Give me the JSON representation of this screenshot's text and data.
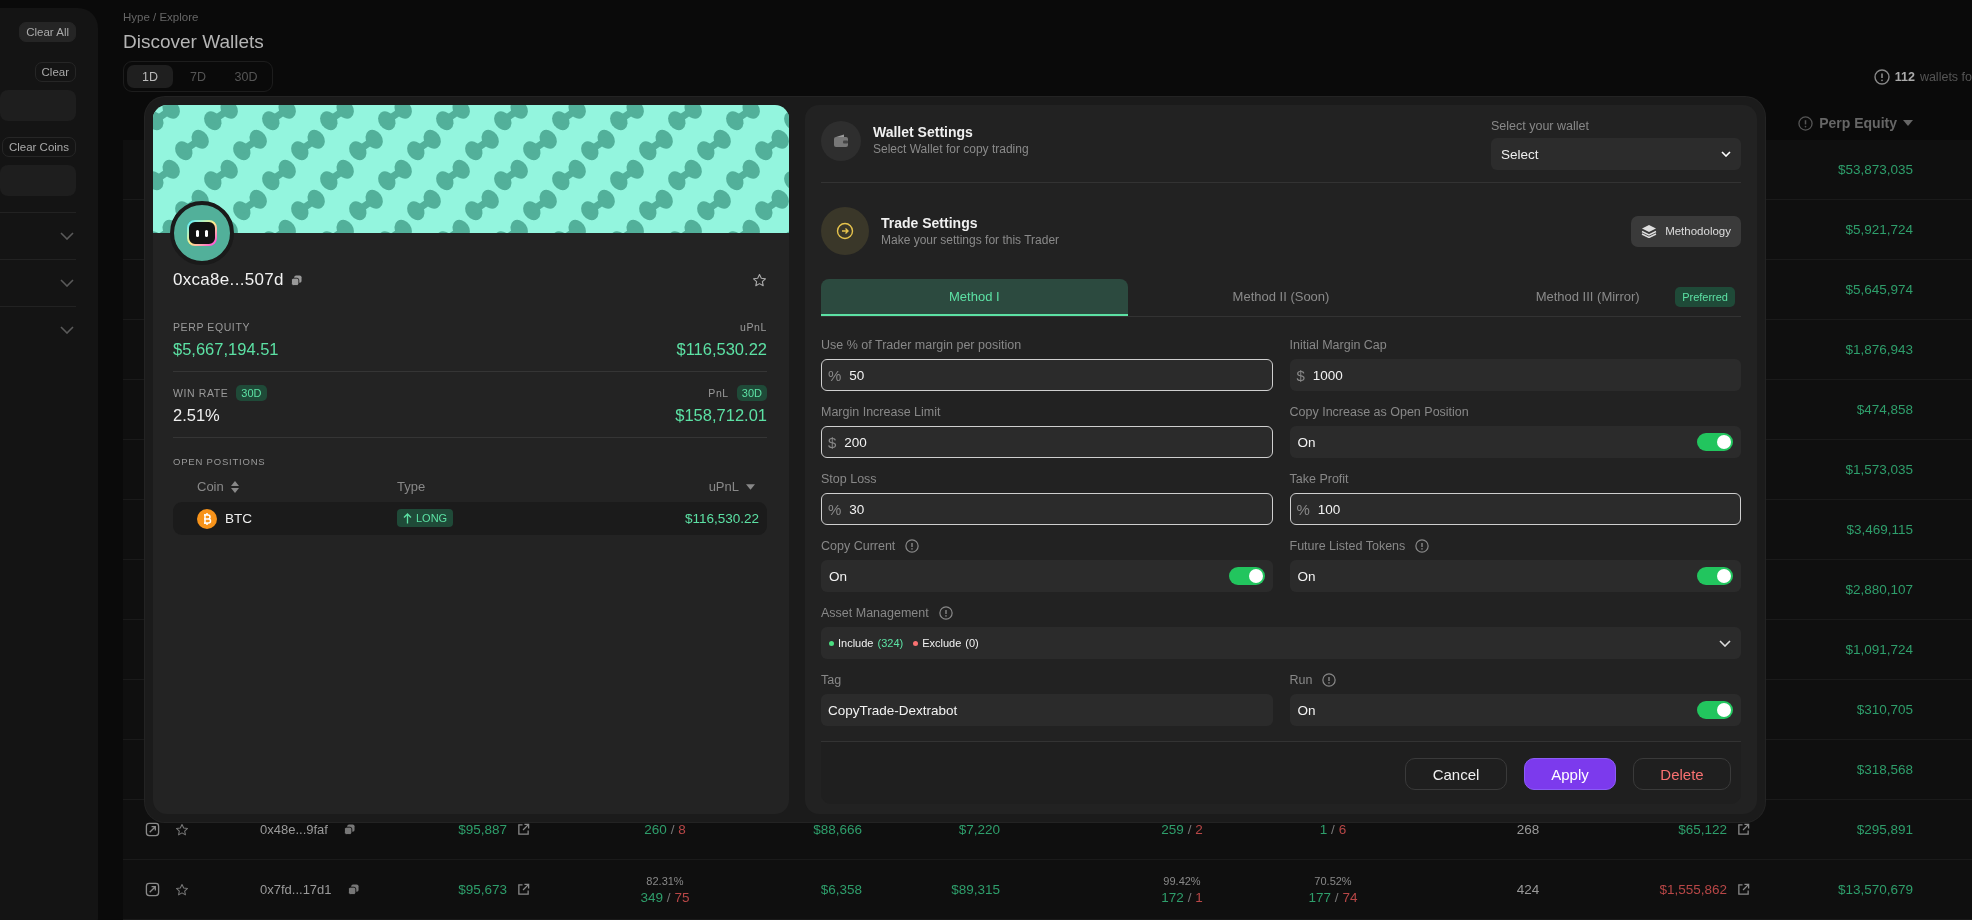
{
  "sidebar": {
    "items": [
      {
        "kind": "action",
        "label": "Clear All",
        "filled": true
      },
      {
        "kind": "action",
        "label": "Clear",
        "filled": false
      },
      {
        "kind": "field"
      },
      {
        "kind": "action",
        "label": "Clear Coins",
        "filled": false
      },
      {
        "kind": "field"
      },
      {
        "kind": "dropdown"
      },
      {
        "kind": "dropdown"
      },
      {
        "kind": "dropdown"
      }
    ]
  },
  "header": {
    "breadcrumb": "Hype / Explore",
    "title": "Discover Wallets",
    "periods": [
      {
        "label": "1D",
        "selected": true
      },
      {
        "label": "7D",
        "selected": false
      },
      {
        "label": "30D",
        "selected": false
      }
    ],
    "wallet_count": {
      "count": "112",
      "text": "wallets fo"
    }
  },
  "table": {
    "columns": [
      {
        "label": "Perp Equity",
        "sorted": true
      }
    ],
    "rows": [
      {
        "perp_equity": "$53,873,035"
      },
      {
        "perp_equity": "$5,921,724"
      },
      {
        "perp_equity": "$5,645,974"
      },
      {
        "perp_equity": "$1,876,943"
      },
      {
        "perp_equity": "$474,858"
      },
      {
        "perp_equity": "$1,573,035"
      },
      {
        "perp_equity": "$3,469,115"
      },
      {
        "perp_equity": "$2,880,107"
      },
      {
        "perp_equity": "$1,091,724"
      },
      {
        "perp_equity": "$310,705"
      },
      {
        "perp_equity": "$318,568"
      },
      {
        "address": "0x48e...9faf",
        "column_3": "$95,887",
        "column_4": {
          "wins": "260",
          "separator": "/",
          "losses": "8"
        },
        "column_5": "$88,666",
        "column_6": "$7,220",
        "column_7": {
          "wins": "259",
          "separator": "/",
          "losses": "2"
        },
        "column_8": {
          "wins": "1",
          "separator": "/",
          "losses": "6"
        },
        "column_9": "268",
        "column_10": {
          "value": "$65,122",
          "loss": false
        },
        "perp_equity": "$295,891"
      },
      {
        "address": "0x7fd...17d1",
        "column_3": "$95,673",
        "column_4": {
          "rate": "82.31%",
          "wins": "349",
          "separator": "/",
          "losses": "75"
        },
        "column_5": "$6,358",
        "column_6": "$89,315",
        "column_7": {
          "rate": "99.42%",
          "wins": "172",
          "separator": "/",
          "losses": "1"
        },
        "column_8": {
          "rate": "70.52%",
          "wins": "177",
          "separator": "/",
          "losses": "74"
        },
        "column_9": "424",
        "column_10": {
          "value": "$1,555,862",
          "loss": true
        },
        "perp_equity": "$13,570,679"
      }
    ]
  },
  "trader": {
    "address": "0xca8e...507d",
    "stats": [
      {
        "label": "PERP EQUITY",
        "value": "$5,667,194.51",
        "gain": true
      },
      {
        "label": "uPnL",
        "value": "$116,530.22",
        "gain": true
      },
      {
        "label": "WIN RATE",
        "badge": "30D",
        "value": "2.51%",
        "gain": false
      },
      {
        "label": "PnL",
        "badge": "30D",
        "value": "$158,712.01",
        "gain": true
      }
    ],
    "open_positions": {
      "title": "OPEN POSITIONS",
      "columns": [
        {
          "label": "Coin",
          "sortable": true,
          "sorted": false
        },
        {
          "label": "Type",
          "sortable": false,
          "sorted": false
        },
        {
          "label": "uPnL",
          "sortable": false,
          "sorted": true
        }
      ],
      "rows": [
        {
          "coin": "BTC",
          "type": "LONG",
          "upnl": "$116,530.22"
        }
      ]
    }
  },
  "settings": {
    "wallet": {
      "title": "Wallet Settings",
      "subtitle": "Select Wallet for copy trading",
      "select_label": "Select your wallet",
      "select_value": "Select"
    },
    "trade": {
      "title": "Trade Settings",
      "subtitle": "Make your settings for this Trader",
      "methodology": "Methodology"
    },
    "methods": [
      {
        "label": "Method I",
        "selected": true
      },
      {
        "label": "Method II (Soon)",
        "selected": false
      },
      {
        "label": "Method III (Mirror)",
        "selected": false,
        "badge": "Preferred"
      }
    ],
    "fields": [
      {
        "kind": "input",
        "label": "Use % of Trader margin per position",
        "prefix": "%",
        "value": "50",
        "outlined": true,
        "info": false
      },
      {
        "kind": "input",
        "label": "Initial Margin Cap",
        "prefix": "$",
        "value": "1000",
        "outlined": false,
        "info": false
      },
      {
        "kind": "input",
        "label": "Margin Increase Limit",
        "prefix": "$",
        "value": "200",
        "outlined": true,
        "info": false
      },
      {
        "kind": "toggle",
        "label": "Copy Increase as Open Position",
        "value": "On",
        "on": true,
        "info": false
      },
      {
        "kind": "input",
        "label": "Stop Loss",
        "prefix": "%",
        "value": "30",
        "outlined": true,
        "info": false
      },
      {
        "kind": "input",
        "label": "Take Profit",
        "prefix": "%",
        "value": "100",
        "outlined": true,
        "info": false
      },
      {
        "kind": "toggle",
        "label": "Copy Current",
        "value": "On",
        "on": true,
        "info": true
      },
      {
        "kind": "toggle",
        "label": "Future Listed Tokens",
        "value": "On",
        "on": true,
        "info": true
      },
      {
        "kind": "assets",
        "label": "Asset Management",
        "info": true,
        "groups": [
          {
            "label": "Include",
            "count": "(324)",
            "color": "#4ade80",
            "highlight": true
          },
          {
            "label": "Exclude",
            "count": "(0)",
            "color": "#f87171",
            "highlight": false
          }
        ]
      },
      {
        "kind": "text",
        "label": "Tag",
        "value": "CopyTrade-Dextrabot",
        "info": false
      },
      {
        "kind": "toggle",
        "label": "Run",
        "value": "On",
        "on": true,
        "info": true
      }
    ],
    "buttons": [
      {
        "label": "Cancel",
        "kind": "secondary"
      },
      {
        "label": "Apply",
        "kind": "primary"
      },
      {
        "label": "Delete",
        "kind": "danger"
      }
    ]
  }
}
